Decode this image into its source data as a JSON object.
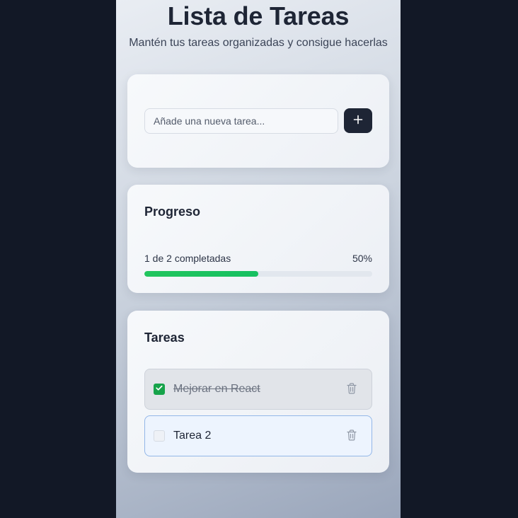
{
  "header": {
    "title": "Lista de Tareas",
    "subtitle": "Mantén tus tareas organizadas y consigue hacerlas"
  },
  "add_task": {
    "placeholder": "Añade una nueva tarea...",
    "button_icon": "plus-icon"
  },
  "progress": {
    "heading": "Progreso",
    "label": "1 de 2 completadas",
    "percent_text": "50%",
    "fraction": 0.5
  },
  "tasks": {
    "heading": "Tareas",
    "items": [
      {
        "text": "Mejorar en React",
        "completed": true,
        "checkbox_icon": "check-icon",
        "delete_icon": "trash-icon"
      },
      {
        "text": "Tarea 2",
        "completed": false,
        "delete_icon": "trash-icon"
      }
    ]
  },
  "colors": {
    "primary": "#1e2535",
    "progress_fill": "#22c55e",
    "checkbox_checked": "#16a34a",
    "active_task_border": "#93b7e8"
  }
}
